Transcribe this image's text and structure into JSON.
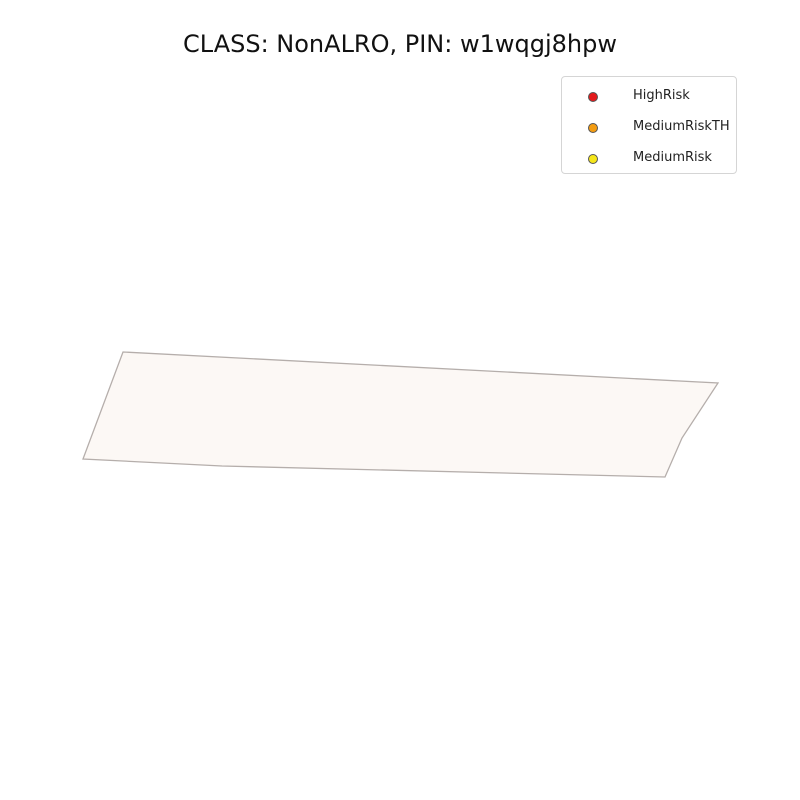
{
  "map": {
    "title": "CLASS: NonALRO, PIN: w1wqgj8hpw",
    "parcel": {
      "fill_color": "#fcf8f5",
      "stroke_color": "#b5aeab"
    }
  },
  "legend": {
    "items": [
      {
        "label": "HighRisk",
        "color": "#e31a1c"
      },
      {
        "label": "MediumRiskTH",
        "color": "#f39c12"
      },
      {
        "label": "MediumRisk",
        "color": "#f5e61a"
      }
    ]
  }
}
